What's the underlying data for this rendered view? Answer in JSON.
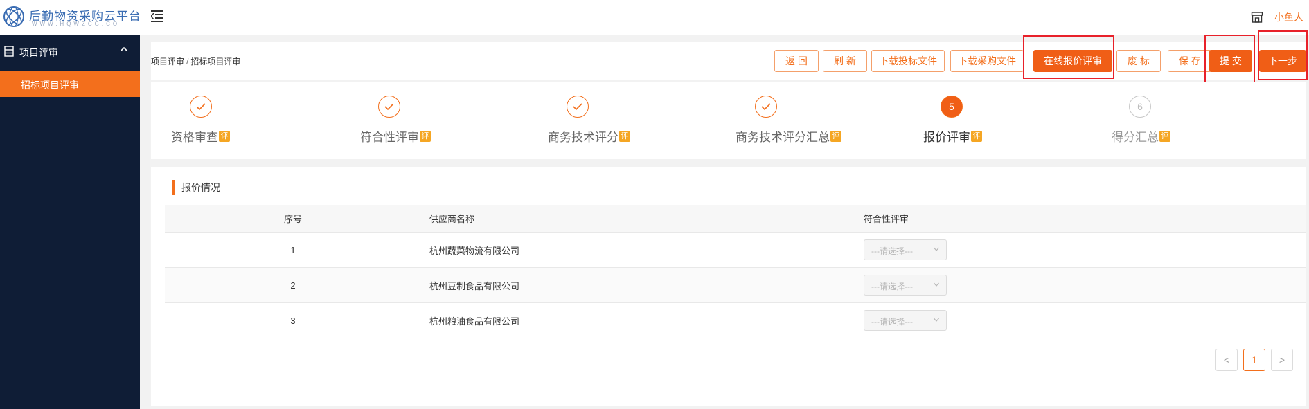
{
  "brand": {
    "name": "后勤物资采购云平台",
    "subtitle": "WWW.HQWZCG.CO"
  },
  "header": {
    "username": "小鱼人"
  },
  "sidebar": {
    "group_label": "项目评审",
    "items": [
      {
        "label": "招标项目评审",
        "active": true
      }
    ]
  },
  "breadcrumb": {
    "items": [
      "项目评审",
      "招标项目评审"
    ],
    "separator": "/"
  },
  "toolbar": {
    "back": "返 回",
    "refresh": "刷 新",
    "download_bid": "下载投标文件",
    "download_purchase": "下载采购文件",
    "online_quote": "在线报价评审",
    "void": "废 标",
    "save": "保 存",
    "submit": "提 交",
    "next": "下一步"
  },
  "steps": {
    "badge": "评",
    "current": 5,
    "items": [
      {
        "label": "资格审查",
        "status": "done"
      },
      {
        "label": "符合性评审",
        "status": "done"
      },
      {
        "label": "商务技术评分",
        "status": "done"
      },
      {
        "label": "商务技术评分汇总",
        "status": "done"
      },
      {
        "label": "报价评审",
        "status": "active",
        "number": "5"
      },
      {
        "label": "得分汇总",
        "status": "pending",
        "number": "6"
      }
    ]
  },
  "quote_section": {
    "title": "报价情况",
    "columns": [
      "序号",
      "供应商名称",
      "符合性评审"
    ],
    "rows": [
      {
        "no": "1",
        "supplier": "杭州蔬菜物流有限公司",
        "review": "---请选择---"
      },
      {
        "no": "2",
        "supplier": "杭州豆制食品有限公司",
        "review": "---请选择---"
      },
      {
        "no": "3",
        "supplier": "杭州粮油食品有限公司",
        "review": "---请选择---"
      }
    ]
  },
  "pagination": {
    "prev": "<",
    "current": "1",
    "next": ">"
  },
  "colors": {
    "accent": "#f36f1c",
    "sidebar_bg": "#0f1d36",
    "badge": "#f5a623",
    "highlight_box": "#e8212a"
  }
}
